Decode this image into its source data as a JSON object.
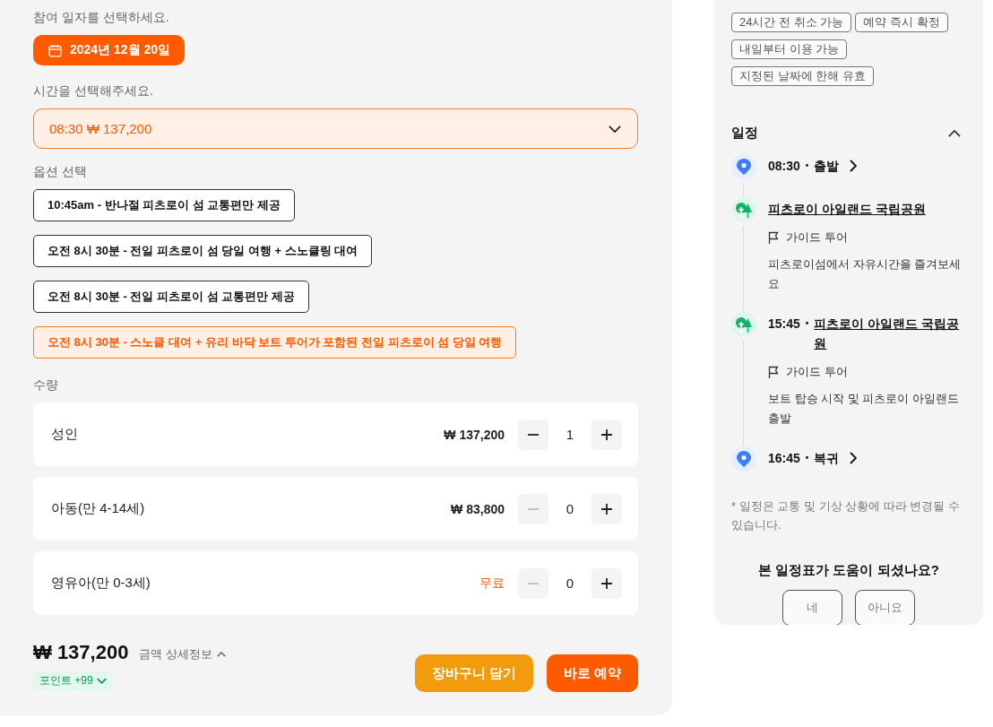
{
  "booking": {
    "date_label": "참여 일자를 선택하세요.",
    "date": "2024년 12월 20일",
    "time_label": "시간을 선택해주세요.",
    "time_value": "08:30 ₩ 137,200",
    "option_label": "옵션 선택",
    "options": [
      {
        "label": "10:45am - 반나절 피츠로이 섬 교통편만 제공",
        "selected": false
      },
      {
        "label": "오전 8시 30분 - 전일 피츠로이 섬 당일 여행 + 스노클링 대여",
        "selected": false
      },
      {
        "label": "오전 8시 30분 - 전일 피츠로이 섬 교통편만 제공",
        "selected": false
      },
      {
        "label": "오전 8시 30분 - 스노클 대여 + 유리 바닥 보트 투어가 포함된 전일 피츠로이 섬 당일 여행",
        "selected": true
      }
    ],
    "quantity_label": "수량",
    "quantities": [
      {
        "name": "성인",
        "price": "₩ 137,200",
        "free": false,
        "count": "1",
        "minus_disabled": false
      },
      {
        "name": "아동(만 4-14세)",
        "price": "₩ 83,800",
        "free": false,
        "count": "0",
        "minus_disabled": true
      },
      {
        "name": "영유아(만 0-3세)",
        "price": "무료",
        "free": true,
        "count": "0",
        "minus_disabled": true
      }
    ],
    "total": "₩ 137,200",
    "detail_link": "금액 상세정보",
    "detail_expanded": true,
    "points": "포인트 +99",
    "points_expanded": false,
    "buttons": [
      {
        "label": "장바구니 담기",
        "kind": "cart"
      },
      {
        "label": "바로 예약",
        "kind": "book"
      }
    ]
  },
  "sidebar": {
    "tags": [
      "24시간 전 취소 가능",
      "예약 즉시 확정",
      "내일부터 이용 가능",
      "지정된 날짜에 한해 유효"
    ],
    "schedule_title": "일정",
    "schedule_expanded": true,
    "schedule": [
      {
        "kind": "pin",
        "time": "08:30",
        "separator": "•",
        "title": "출발",
        "title_link": false,
        "chevron": true
      },
      {
        "kind": "park",
        "title": "피츠로이 아일랜드 국립공원",
        "title_link": true,
        "chevron": false,
        "tag": "가이드 투어",
        "description": "피츠로이섬에서 자유시간을 즐겨보세요"
      },
      {
        "kind": "park",
        "time": "15:45",
        "separator": "•",
        "title": "피츠로이 아일랜드 국립공원",
        "title_link": true,
        "chevron": false,
        "tag": "가이드 투어",
        "description": "보트 탑승 시작 및 피츠로이 아일랜드 출발"
      },
      {
        "kind": "pin",
        "time": "16:45",
        "separator": "•",
        "title": "복귀",
        "title_link": false,
        "chevron": true
      }
    ],
    "note": "* 일정은 교통 및 기상 상황에 따라 변경될 수 있습니다.",
    "feedback_question": "본 일정표가 도움이 되셨나요?",
    "feedback_buttons": [
      "네",
      "아니요"
    ]
  }
}
